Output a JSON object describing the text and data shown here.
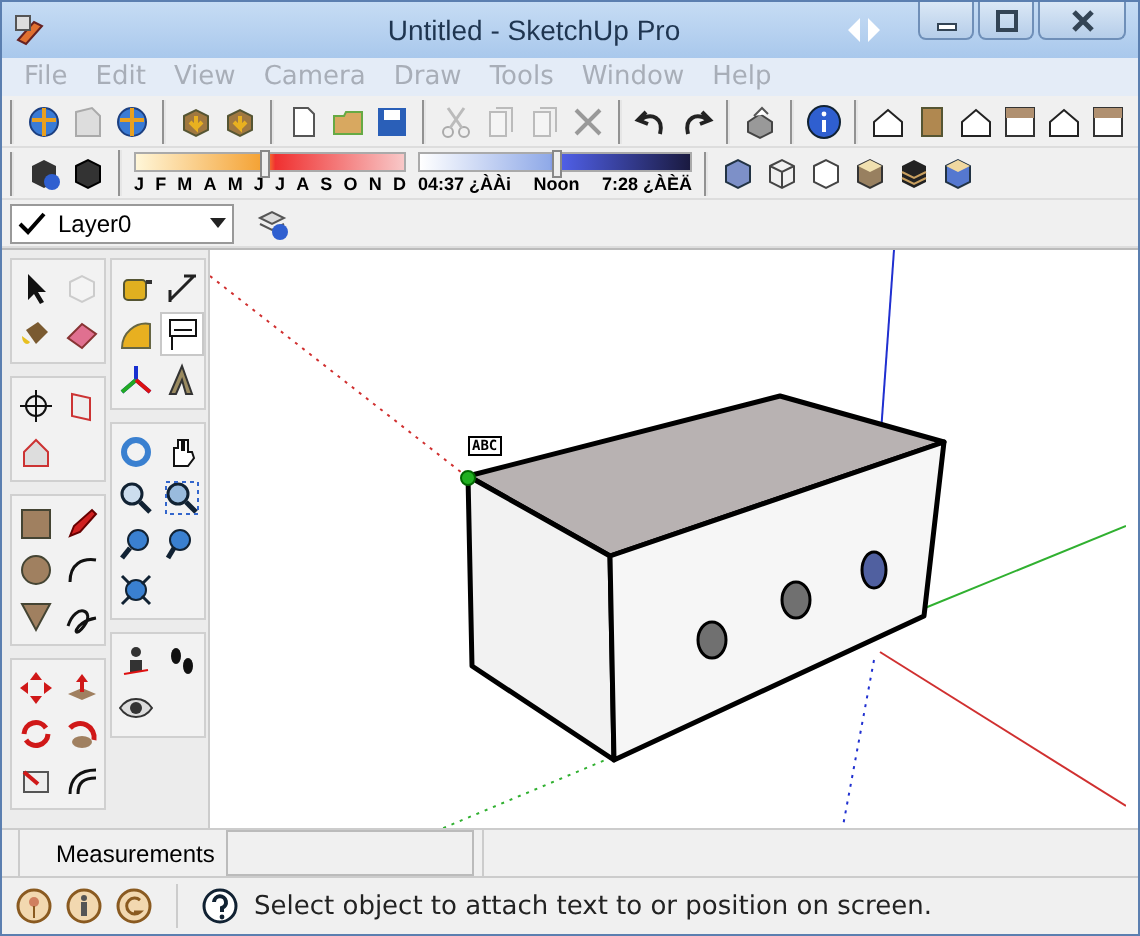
{
  "window": {
    "title": "Untitled - SketchUp Pro"
  },
  "menus": [
    {
      "label": "File"
    },
    {
      "label": "Edit"
    },
    {
      "label": "View"
    },
    {
      "label": "Camera"
    },
    {
      "label": "Draw"
    },
    {
      "label": "Tools"
    },
    {
      "label": "Window"
    },
    {
      "label": "Help"
    }
  ],
  "shadow_settings": {
    "months": [
      "J",
      "F",
      "M",
      "A",
      "M",
      "J",
      "J",
      "A",
      "S",
      "O",
      "N",
      "D"
    ],
    "month_slider": {
      "level": 0.48
    },
    "time_start": "04:37 ¿ÀÀi",
    "time_middle": "Noon",
    "time_end": "7:28 ¿ÀÈÄ",
    "time_slider": {
      "level": 0.5
    }
  },
  "layer_bar": {
    "current_layer": "Layer0"
  },
  "tool_palette": {
    "left": [
      [
        {
          "kind": "select",
          "selected": false
        },
        {
          "kind": "component",
          "selected": false
        },
        {
          "kind": "paint",
          "selected": false
        },
        {
          "kind": "eraser",
          "selected": false
        }
      ],
      [
        {
          "kind": "section",
          "selected": false
        },
        {
          "kind": "section-display",
          "selected": false
        },
        {
          "kind": "section-cut",
          "selected": false
        }
      ],
      [
        {
          "kind": "rectangle",
          "selected": false
        },
        {
          "kind": "pencil",
          "selected": false
        },
        {
          "kind": "circle",
          "selected": false
        },
        {
          "kind": "arc",
          "selected": false
        },
        {
          "kind": "polygon",
          "selected": false
        },
        {
          "kind": "freehand",
          "selected": false
        }
      ],
      [
        {
          "kind": "move",
          "selected": false
        },
        {
          "kind": "pushpull",
          "selected": false
        },
        {
          "kind": "rotate",
          "selected": false
        },
        {
          "kind": "followme",
          "selected": false
        },
        {
          "kind": "scale",
          "selected": false
        },
        {
          "kind": "offset",
          "selected": false
        }
      ]
    ],
    "right": [
      [
        {
          "kind": "tape",
          "selected": false
        },
        {
          "kind": "dimension",
          "selected": false
        },
        {
          "kind": "protractor",
          "selected": false
        },
        {
          "kind": "text",
          "selected": true
        },
        {
          "kind": "axes",
          "selected": false
        },
        {
          "kind": "text3d",
          "selected": false
        }
      ],
      [
        {
          "kind": "orbit",
          "selected": false
        },
        {
          "kind": "pan",
          "selected": false
        },
        {
          "kind": "zoom",
          "selected": false
        },
        {
          "kind": "zoom-window",
          "selected": false
        },
        {
          "kind": "previous",
          "selected": false
        },
        {
          "kind": "next",
          "selected": false
        },
        {
          "kind": "zoom-extents",
          "selected": false
        }
      ],
      [
        {
          "kind": "position-camera",
          "selected": false
        },
        {
          "kind": "walk",
          "selected": false
        },
        {
          "kind": "look-around",
          "selected": false
        }
      ]
    ]
  },
  "viewport": {
    "text_label": "ABC"
  },
  "measurements": {
    "label": "Measurements"
  },
  "status_bar": {
    "message": "Select object to attach text to or position on screen."
  }
}
